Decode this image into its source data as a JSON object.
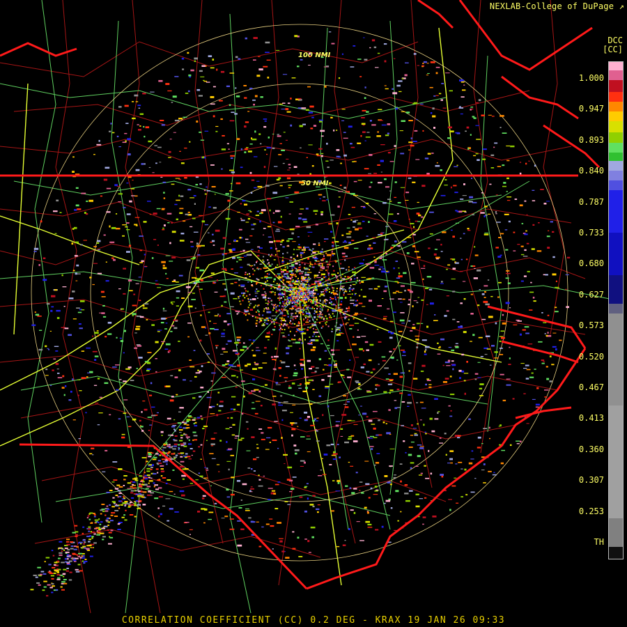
{
  "credit": "NEXLAB-College of DuPage",
  "product_line": "CORRELATION COEFFICIENT (CC) 0.2 DEG - KRAX 19 JAN 26 09:33",
  "units": {
    "product": "DCC",
    "unit": "[CC]"
  },
  "scale_labels": [
    "1.000",
    "0.947",
    "0.893",
    "0.840",
    "0.787",
    "0.733",
    "0.680",
    "0.627",
    "0.573",
    "0.520",
    "0.467",
    "0.413",
    "0.360",
    "0.307",
    "0.253",
    "TH"
  ],
  "ring_labels": {
    "inner": "50 NMI",
    "outer": "100 NMI"
  },
  "colors": {
    "background": "#000000",
    "state_border": "#ff1a1a",
    "county_line": "#b01818",
    "highway": "#66dd66",
    "interstate": "#e6ff33",
    "ring": "#e8d080",
    "text": "#ffff66"
  },
  "icons": {
    "external_link": "external-link-icon"
  }
}
